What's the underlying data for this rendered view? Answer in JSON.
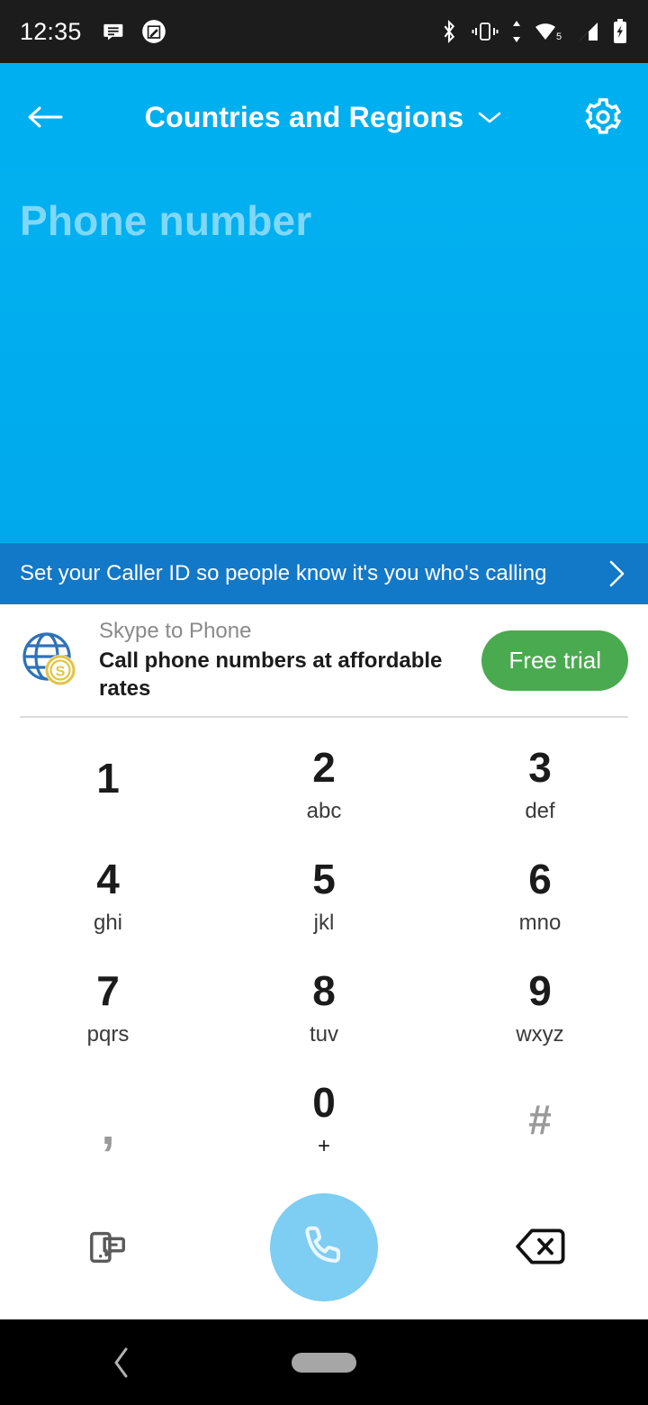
{
  "status_bar": {
    "time": "12:35",
    "left_icons": [
      "messages-icon",
      "screenshot-icon"
    ],
    "right_icons": [
      "bluetooth-icon",
      "vibrate-icon",
      "data-transfer-icon",
      "wifi-icon",
      "cellular-signal-icon",
      "battery-charging-icon"
    ],
    "wifi_badge": "5",
    "background": "#1c1c1c"
  },
  "header": {
    "title": "Countries and Regions",
    "back_icon": "back-arrow-icon",
    "dropdown_icon": "chevron-down-icon",
    "settings_icon": "gear-icon",
    "background": "#00aff0"
  },
  "dial_display": {
    "placeholder": "Phone number",
    "value": "",
    "placeholder_color": "#7fd8f7"
  },
  "caller_id_banner": {
    "text": "Set your Caller ID so people know it's you who's calling",
    "chevron_icon": "chevron-right-icon",
    "background": "#1278c8"
  },
  "promo": {
    "icon": "globe-dollar-icon",
    "kicker": "Skype to Phone",
    "title": "Call phone numbers at affordable rates",
    "button_label": "Free trial",
    "button_color": "#4aaa4f"
  },
  "keypad": {
    "keys": [
      {
        "digit": "1",
        "sub": ""
      },
      {
        "digit": "2",
        "sub": "abc"
      },
      {
        "digit": "3",
        "sub": "def"
      },
      {
        "digit": "4",
        "sub": "ghi"
      },
      {
        "digit": "5",
        "sub": "jkl"
      },
      {
        "digit": "6",
        "sub": "mno"
      },
      {
        "digit": "7",
        "sub": "pqrs"
      },
      {
        "digit": "8",
        "sub": "tuv"
      },
      {
        "digit": "9",
        "sub": "wxyz"
      },
      {
        "digit": ",",
        "sub": ""
      },
      {
        "digit": "0",
        "sub": "+"
      },
      {
        "digit": "#",
        "sub": ""
      }
    ]
  },
  "actions": {
    "sms_icon": "sms-phone-icon",
    "call_icon": "phone-handset-icon",
    "call_button_color": "#7ecdf2",
    "backspace_icon": "backspace-icon"
  },
  "nav_bar": {
    "back_icon": "nav-back-icon",
    "home_icon": "nav-home-pill"
  }
}
